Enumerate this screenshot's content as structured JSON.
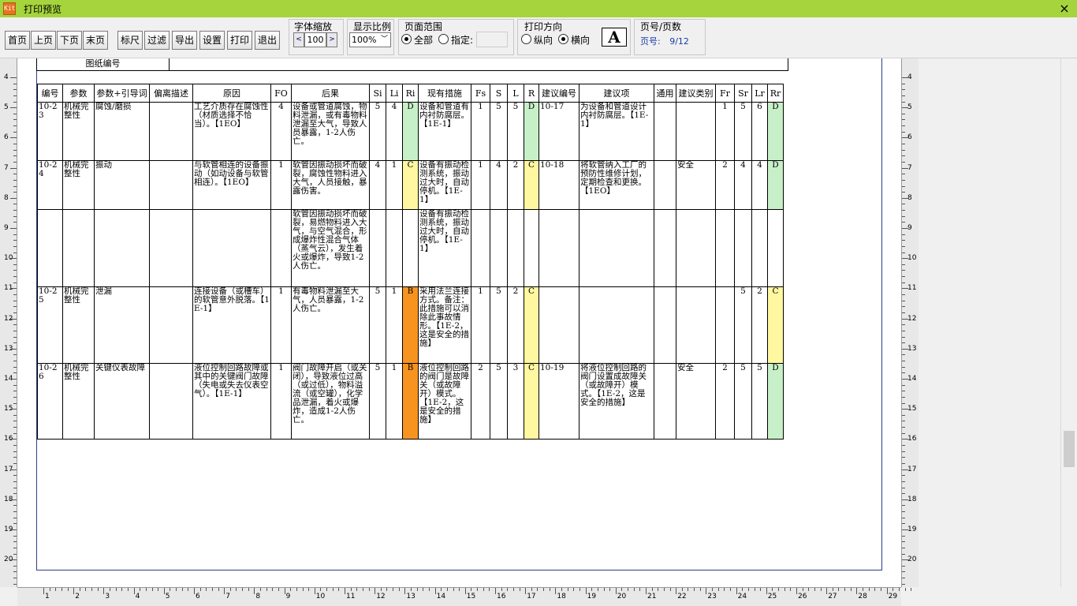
{
  "window": {
    "title": "打印预览",
    "icon": "app-icon",
    "close": "×"
  },
  "toolbar": {
    "buttons": [
      "首页",
      "上页",
      "下页",
      "末页",
      "标尺",
      "过滤",
      "导出",
      "设置",
      "打印",
      "退出"
    ],
    "font_scale": {
      "label": "字体缩放",
      "value": "100",
      "dec": "<",
      "inc": ">"
    },
    "zoom": {
      "label": "显示比例",
      "value": "100%"
    },
    "page_range": {
      "label": "页面范围",
      "all": "全部",
      "specify": "指定:",
      "selected": "all"
    },
    "orientation": {
      "label": "打印方向",
      "portrait": "纵向",
      "landscape": "横向",
      "selected": "landscape",
      "icon_letter": "A"
    },
    "page_num": {
      "label": "页号/页数",
      "text": "页号:",
      "value": "9/12"
    }
  },
  "doc": {
    "drawing_no_label": "图纸编号"
  },
  "table": {
    "headers": [
      "编号",
      "参数",
      "参数+引导词",
      "偏离描述",
      "原因",
      "FO",
      "后果",
      "Si",
      "Li",
      "Ri",
      "现有措施",
      "Fs",
      "S",
      "L",
      "R",
      "建议编号",
      "建议项",
      "通用",
      "建议类别",
      "Fr",
      "Sr",
      "Lr",
      "Rr"
    ],
    "rows": [
      {
        "id": "10-23",
        "param": "机械完整性",
        "guide": "腐蚀/磨损",
        "dev": "",
        "cause": "工艺介质存在腐蚀性（材质选择不恰当）。【1EO】",
        "fo": "4",
        "consequence": "设备或管道腐蚀，物料泄漏，或有毒物料泄漏至大气，导致人员暴露，1-2人伤亡。",
        "si": "5",
        "li": "4",
        "ri": "D",
        "measure": "设备和管道有内衬防腐层。【1E-1】",
        "fs": "1",
        "s": "5",
        "l": "5",
        "r": "D",
        "sugno": "10-17",
        "sug": "为设备和管道设计内衬防腐层。【1E-1】",
        "gen": "",
        "cat": "",
        "fr": "1",
        "sr": "5",
        "lr": "6",
        "rr": "D"
      },
      {
        "id": "10-24",
        "param": "机械完整性",
        "guide": "振动",
        "dev": "",
        "cause": "与软管相连的设备振动（如动设备与软管相连）。【1EO】",
        "fo": "1",
        "consequence": "软管因振动损坏而破裂，腐蚀性物料进入大气，人员接触，暴露伤害。",
        "si": "4",
        "li": "1",
        "ri": "C",
        "measure": "设备有振动检测系统，振动过大时，自动停机。【1E-1】",
        "fs": "1",
        "s": "4",
        "l": "2",
        "r": "C",
        "sugno": "10-18",
        "sug": "将软管纳入工厂的预防性维修计划，定期检查和更换。【1EO】",
        "gen": "",
        "cat": "安全",
        "fr": "2",
        "sr": "4",
        "lr": "4",
        "rr": "D"
      },
      {
        "consequence2": "软管因振动损坏而破裂，易燃物料进入大气，与空气混合，形成爆炸性混合气体（蒸气云），发生着火或爆炸，导致1-2人伤亡。",
        "measure2": "设备有振动检测系统，振动过大时，自动停机。【1E-1】"
      },
      {
        "id": "10-25",
        "param": "机械完整性",
        "guide": "泄漏",
        "dev": "",
        "cause": "连接设备（或槽车）的软管意外脱落。【1E-1】",
        "fo": "1",
        "consequence": "有毒物料泄漏至大气，人员暴露，1-2人伤亡。",
        "si": "5",
        "li": "1",
        "ri": "B",
        "measure": "采用法兰连接方式。备注：此措施可以消除此事故情形。【1E-2，这是安全的措施】",
        "fs": "1",
        "s": "5",
        "l": "2",
        "r": "C",
        "sugno": "",
        "sug": "",
        "gen": "",
        "cat": "",
        "fr": "",
        "sr": "5",
        "lr": "2",
        "rr": "C"
      },
      {
        "id": "10-26",
        "param": "机械完整性",
        "guide": "关键仪表故障",
        "dev": "",
        "cause": "液位控制回路故障或其中的关键阀门故障（失电或失去仪表空气）。【1E-1】",
        "fo": "1",
        "consequence": "阀门故障开启（或关闭），导致液位过高（或过低），物料溢流（或空罐），化学品泄漏，着火或爆炸，造成1-2人伤亡。",
        "si": "5",
        "li": "1",
        "ri": "B",
        "measure": "液位控制回路的阀门是故障关（或故障开）模式。【1E-2，这是安全的措施】",
        "fs": "2",
        "s": "5",
        "l": "3",
        "r": "C",
        "sugno": "10-19",
        "sug": "将液位控制回路的阀门设置成故障关（或故障开）模式。【1E-2，这是安全的措施】",
        "gen": "",
        "cat": "安全",
        "fr": "2",
        "sr": "5",
        "lr": "5",
        "rr": "D"
      }
    ]
  },
  "colors": {
    "green": "#c8f0c8",
    "yellow": "#fff8a0",
    "orange": "#f79420",
    "titlebar": "#a5d43c"
  }
}
